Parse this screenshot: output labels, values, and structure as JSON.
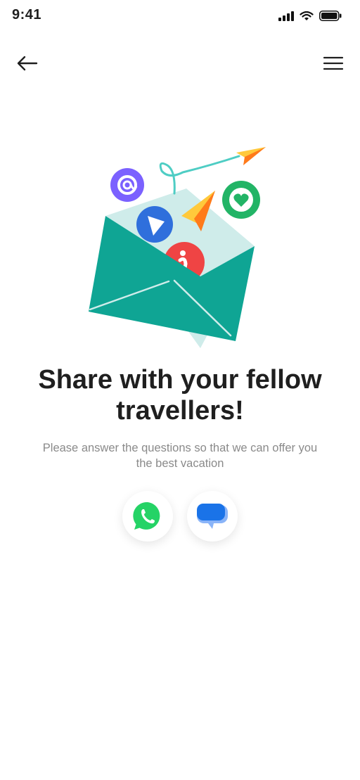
{
  "status_bar": {
    "time": "9:41"
  },
  "nav": {
    "back_icon": "arrow-left-icon",
    "menu_icon": "hamburger-menu-icon"
  },
  "content": {
    "title": "Share with your fellow travellers!",
    "subtitle": "Please answer the questions so that we can offer you the best vacation"
  },
  "share_options": [
    {
      "icon": "whatsapp-icon",
      "color": "#25D366"
    },
    {
      "icon": "messages-icon",
      "color": "#1A73E8"
    }
  ],
  "colors": {
    "envelope": "#0fa594",
    "envelope_inner": "#cfecea",
    "accent_orange": "#ff7a1a",
    "accent_yellow": "#ffc93b",
    "email_purple": "#7b61ff",
    "play_blue": "#2f6fdc",
    "info_red": "#ef4444",
    "heart_green": "#22b466"
  }
}
